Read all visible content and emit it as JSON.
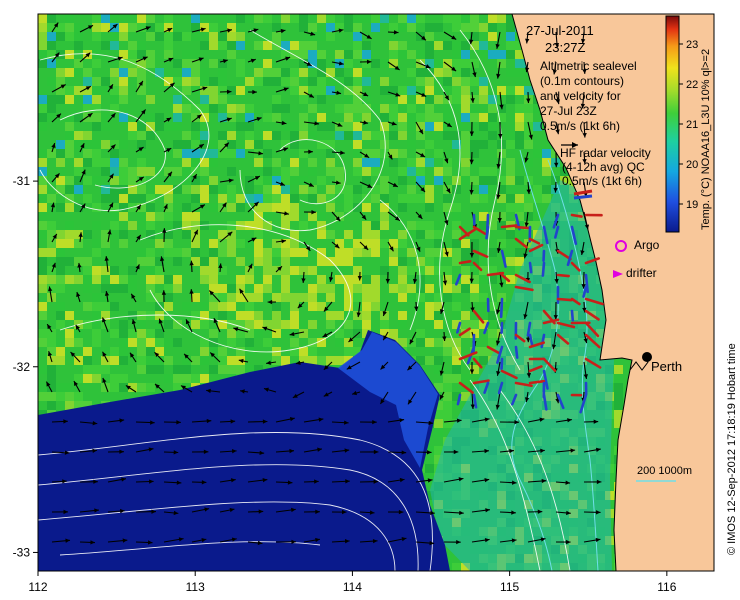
{
  "header": {
    "date": "27-Jul-2011",
    "time": "23:27Z"
  },
  "legend": {
    "altimetry_lines": [
      "Altimetric sealevel",
      "(0.1m contours)",
      "and velocity for",
      "27-Jul 23Z",
      "0.5m/s (1kt 6h)"
    ],
    "radar_lines": [
      "HF radar velocity",
      "(4-12h avg) QC",
      "0.5m/s (1kt 6h)"
    ],
    "argo_label": "Argo",
    "drifter_label": "drifter"
  },
  "colorbar": {
    "label": "Temp. (°C) NOAA16_L3U 10% ql>=2",
    "ticks": [
      "23",
      "22",
      "21",
      "20",
      "19"
    ],
    "tick_values": [
      23,
      22,
      21,
      20,
      19
    ],
    "vmin": 18.3,
    "vmax": 23.7
  },
  "axes": {
    "x_ticks": [
      "112",
      "113",
      "114",
      "115",
      "116"
    ],
    "x_values": [
      112,
      113,
      114,
      115,
      116
    ],
    "y_ticks": [
      "-31",
      "-32",
      "-33"
    ],
    "y_values": [
      -31,
      -32,
      -33
    ],
    "xlim": [
      112,
      116.3
    ],
    "ylim": [
      -33.1,
      -30.1
    ]
  },
  "city": {
    "name": "Perth",
    "lon": 115.86,
    "lat": -31.95
  },
  "scale_bar": {
    "label": "200  1000m"
  },
  "credit": "© IMOS 12-Sep-2012 17:18:19 Hobart time",
  "colors": {
    "land": "#f8c79a",
    "deep_water": "#0a1a8c",
    "radar_red": "#c8201a",
    "radar_blue": "#2244cc",
    "argo": "#e000e0",
    "drifter": "#e000e0",
    "contour": "#ffffff",
    "isobath": "#6fdfe8"
  }
}
